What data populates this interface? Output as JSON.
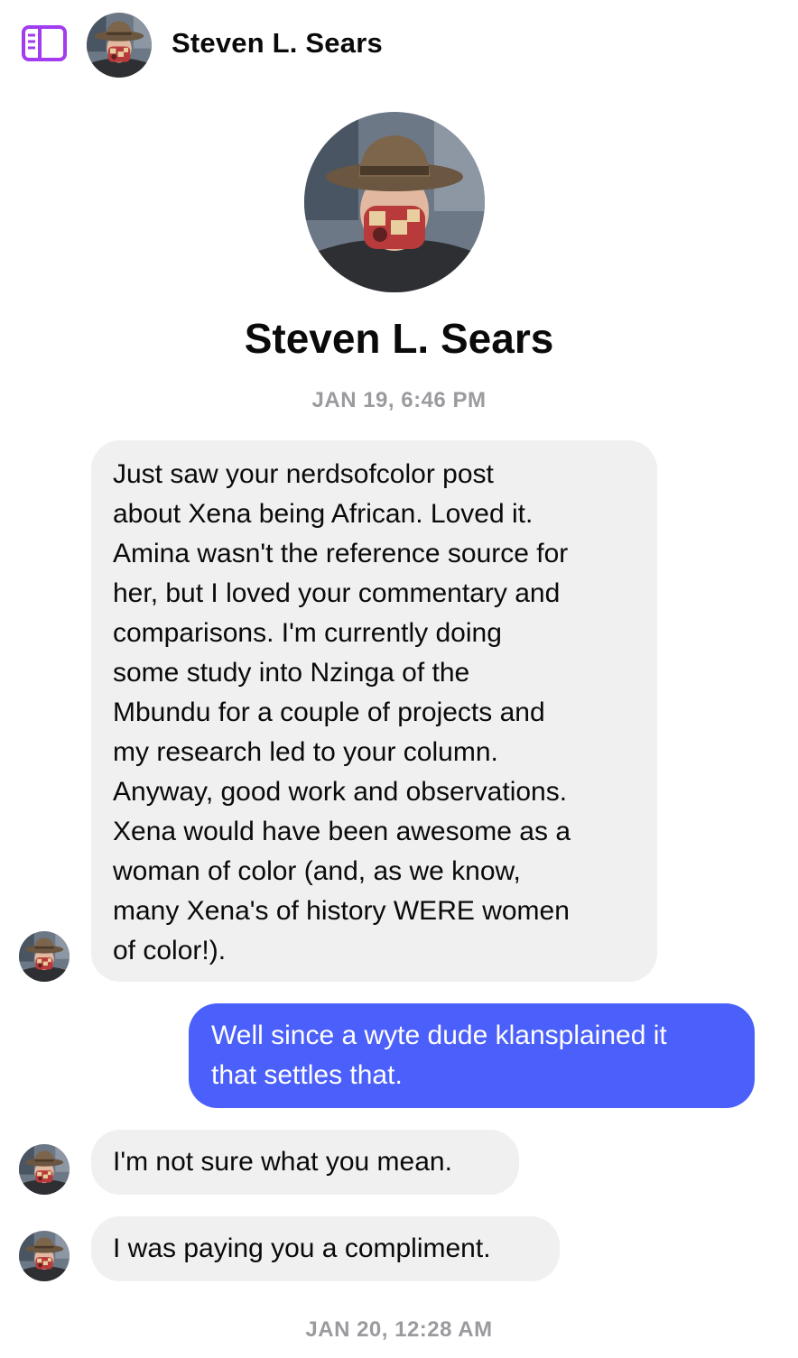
{
  "header": {
    "contact_name": "Steven L. Sears",
    "sidebar_icon": "sidebar-toggle-icon",
    "accent_color": "#a23cf0"
  },
  "profile": {
    "name": "Steven L. Sears",
    "avatar": "contact-avatar"
  },
  "conversation": {
    "timestamps": [
      "JAN 19, 6:46 PM",
      "JAN 20, 12:28 AM"
    ],
    "messages": [
      {
        "direction": "incoming",
        "lines": [
          "Just saw your nerdsofcolor post",
          "about Xena being African. Loved it.",
          "Amina wasn't the reference source for",
          "her, but I loved your commentary and",
          "comparisons. I'm currently doing",
          "some study into Nzinga of the",
          "Mbundu for a couple of projects and",
          "my research led to your column.",
          "Anyway, good work and observations.",
          "Xena would have been awesome as a",
          "woman of color (and, as we know,",
          "many Xena's of history WERE women",
          "of color!)."
        ]
      },
      {
        "direction": "outgoing",
        "lines": [
          "Well since a wyte dude klansplained it",
          "that settles that."
        ]
      },
      {
        "direction": "incoming",
        "lines": [
          "I'm not sure what you mean."
        ]
      },
      {
        "direction": "incoming",
        "lines": [
          "I was paying you a compliment."
        ]
      }
    ]
  },
  "colors": {
    "incoming_bubble": "#f0f0f0",
    "outgoing_bubble": "#4b5ffa",
    "timestamp_text": "#9b9b9f"
  }
}
